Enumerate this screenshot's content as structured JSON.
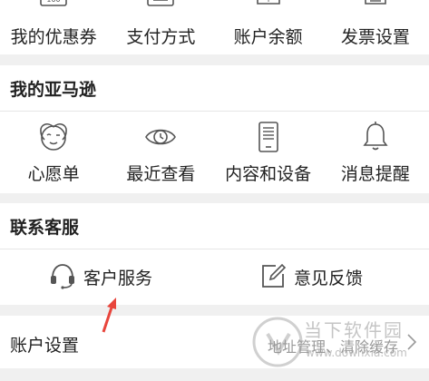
{
  "account_grid": {
    "items": [
      {
        "label": "我的优惠券",
        "icon": "coupon-icon"
      },
      {
        "label": "支付方式",
        "icon": "payment-card-icon"
      },
      {
        "label": "账户余额",
        "icon": "balance-icon"
      },
      {
        "label": "发票设置",
        "icon": "invoice-icon"
      }
    ]
  },
  "my_amazon": {
    "title": "我的亚马逊",
    "items": [
      {
        "label": "心愿单",
        "icon": "wishlist-face-icon"
      },
      {
        "label": "最近查看",
        "icon": "recently-viewed-eye-icon"
      },
      {
        "label": "内容和设备",
        "icon": "tablet-device-icon"
      },
      {
        "label": "消息提醒",
        "icon": "bell-icon"
      }
    ]
  },
  "customer_service": {
    "title": "联系客服",
    "items": [
      {
        "label": "客户服务",
        "icon": "headset-icon"
      },
      {
        "label": "意见反馈",
        "icon": "feedback-edit-icon"
      }
    ]
  },
  "account_settings": {
    "label": "账户设置",
    "subtitle": "地址管理、清除缓存"
  },
  "watermark": {
    "title": "当下软件园",
    "url": "www.downxia.com"
  },
  "colors": {
    "background": "#f0f0f0",
    "card": "#ffffff",
    "text": "#222222",
    "secondary_text": "#999999",
    "icon_stroke": "#555555",
    "annotation_arrow": "#e8453c"
  }
}
